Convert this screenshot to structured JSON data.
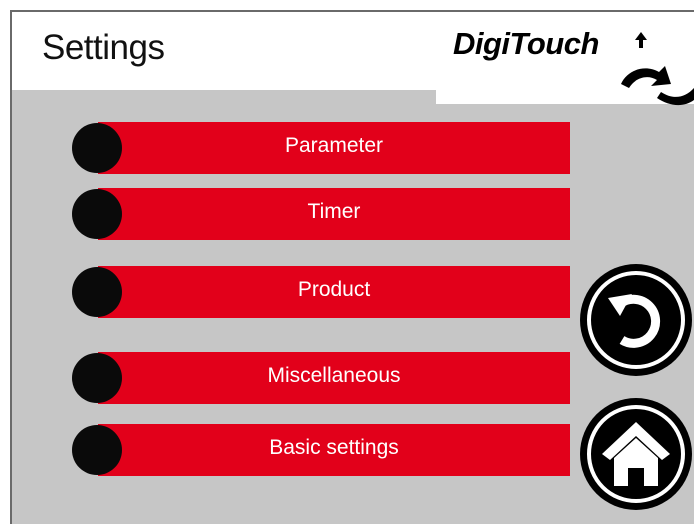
{
  "header": {
    "title": "Settings",
    "logo_text": "DigiTouch"
  },
  "menu": {
    "items": [
      {
        "label": "Parameter"
      },
      {
        "label": "Timer"
      },
      {
        "label": "Product"
      },
      {
        "label": "Miscellaneous"
      },
      {
        "label": "Basic settings"
      }
    ]
  },
  "nav": {
    "back_icon": "back-arrow-icon",
    "home_icon": "home-icon"
  },
  "colors": {
    "accent": "#e2001a",
    "background": "#c6c6c6",
    "knob": "#0a0a0a"
  }
}
